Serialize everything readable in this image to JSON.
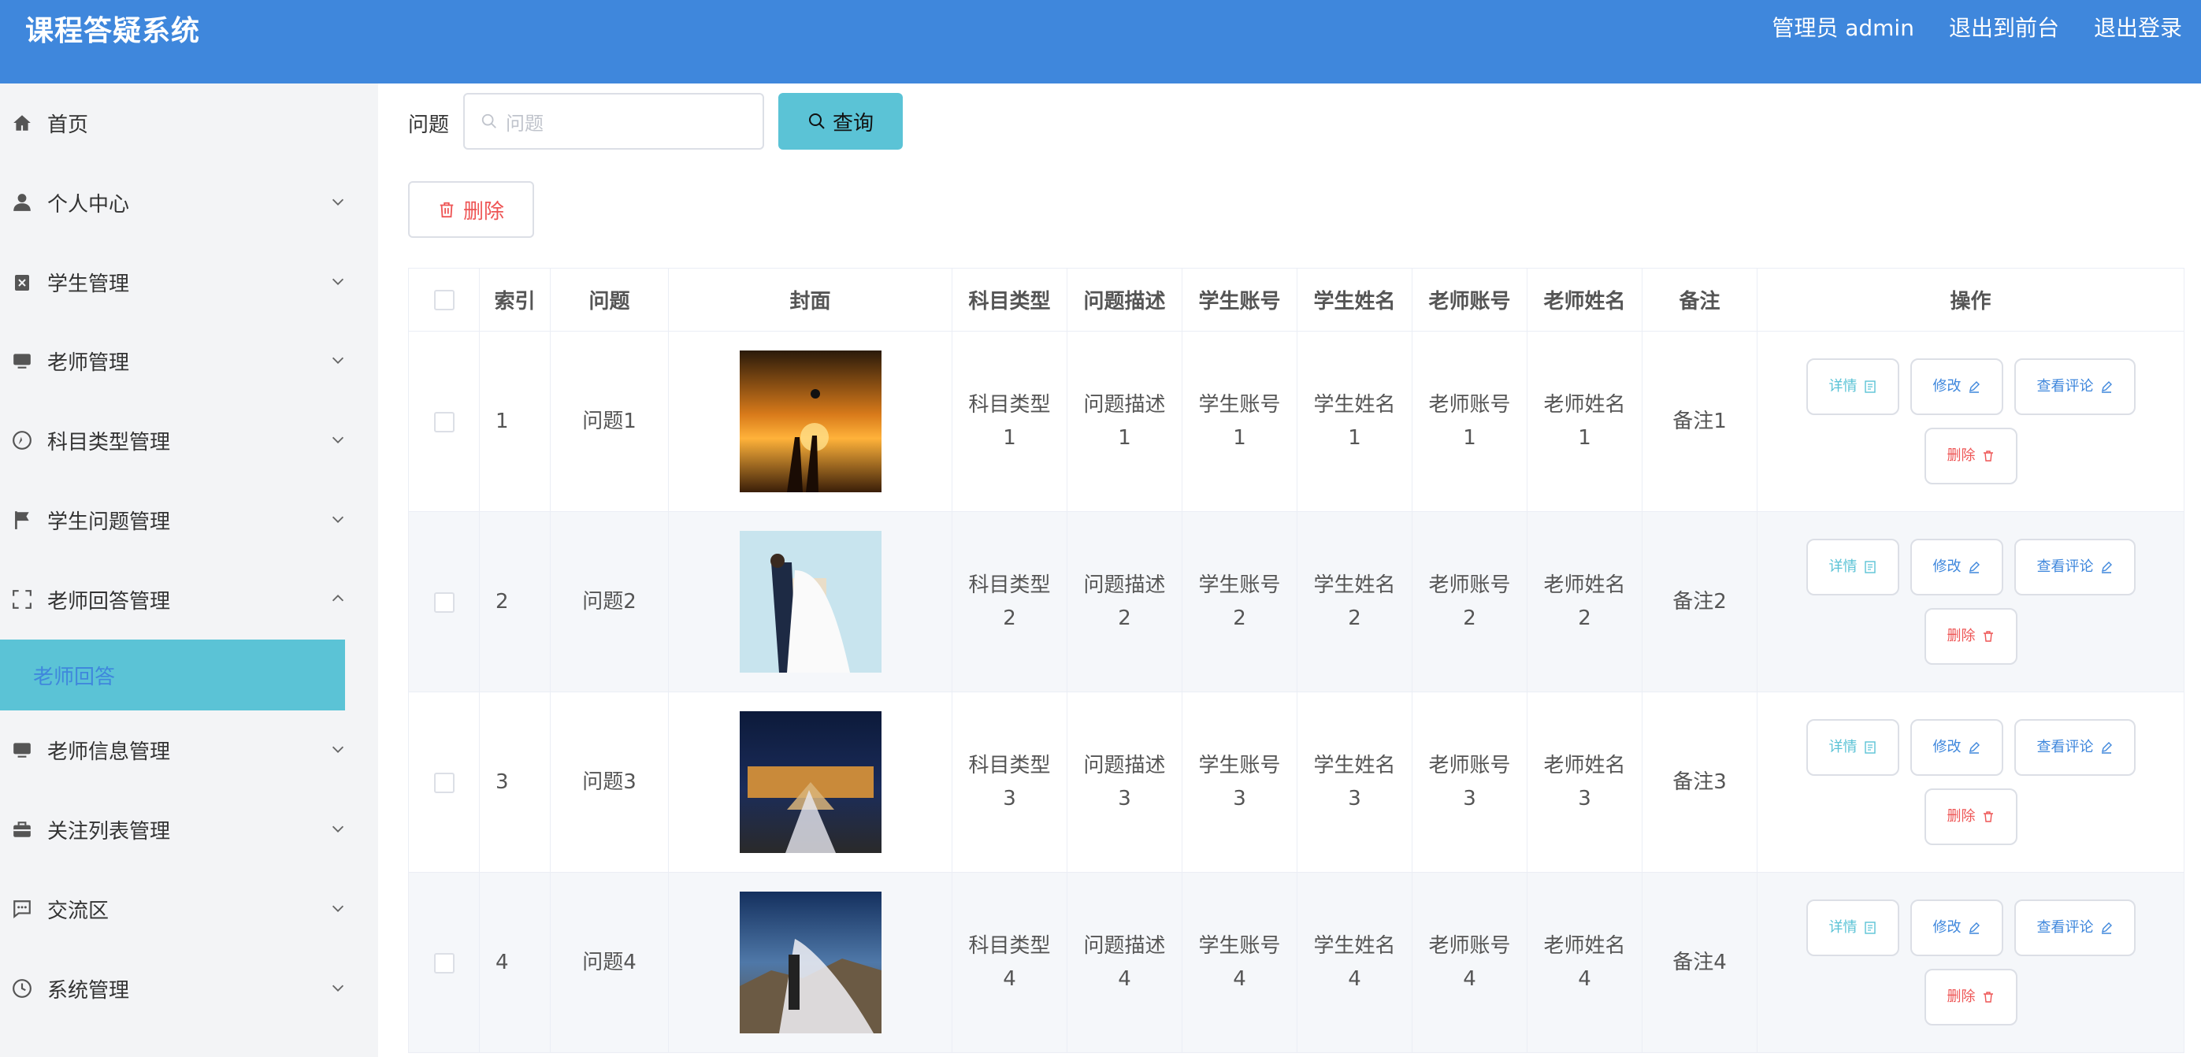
{
  "header": {
    "title": "课程答疑系统",
    "user": "管理员 admin",
    "to_front": "退出到前台",
    "logout": "退出登录"
  },
  "sidebar": {
    "items": [
      {
        "label": "首页",
        "icon": "home-icon"
      },
      {
        "label": "个人中心",
        "icon": "user-icon"
      },
      {
        "label": "学生管理",
        "icon": "clipboard-icon"
      },
      {
        "label": "老师管理",
        "icon": "monitor-icon"
      },
      {
        "label": "科目类型管理",
        "icon": "compass-icon"
      },
      {
        "label": "学生问题管理",
        "icon": "flag-icon"
      },
      {
        "label": "老师回答管理",
        "icon": "frame-icon"
      },
      {
        "label": "老师信息管理",
        "icon": "monitor-icon"
      },
      {
        "label": "关注列表管理",
        "icon": "briefcase-icon"
      },
      {
        "label": "交流区",
        "icon": "chat-icon"
      },
      {
        "label": "系统管理",
        "icon": "clock-icon"
      }
    ],
    "active_sub": "老师回答"
  },
  "search": {
    "label": "问题",
    "placeholder": "问题",
    "button": "查询"
  },
  "toolbar": {
    "delete": "删除"
  },
  "table": {
    "headers": [
      "索引",
      "问题",
      "封面",
      "科目类型",
      "问题描述",
      "学生账号",
      "学生姓名",
      "老师账号",
      "老师姓名",
      "备注",
      "操作"
    ],
    "actions": {
      "detail": "详情",
      "edit": "修改",
      "comment": "查看评论",
      "delete": "删除"
    },
    "rows": [
      {
        "index": "1",
        "question": "问题1",
        "subject": "科目类型1",
        "desc": "问题描述1",
        "stu_acc": "学生账号1",
        "stu_name": "学生姓名1",
        "tch_acc": "老师账号1",
        "tch_name": "老师姓名1",
        "note": "备注1",
        "cover": "sunset-couple"
      },
      {
        "index": "2",
        "question": "问题2",
        "subject": "科目类型2",
        "desc": "问题描述2",
        "stu_acc": "学生账号2",
        "stu_name": "学生姓名2",
        "tch_acc": "老师账号2",
        "tch_name": "老师姓名2",
        "note": "备注2",
        "cover": "wedding-studio"
      },
      {
        "index": "3",
        "question": "问题3",
        "subject": "科目类型3",
        "desc": "问题描述3",
        "stu_acc": "学生账号3",
        "stu_name": "学生姓名3",
        "tch_acc": "老师账号3",
        "tch_name": "老师姓名3",
        "note": "备注3",
        "cover": "night-palace"
      },
      {
        "index": "4",
        "question": "问题4",
        "subject": "科目类型4",
        "desc": "问题描述4",
        "stu_acc": "学生账号4",
        "stu_name": "学生姓名4",
        "tch_acc": "老师账号4",
        "tch_name": "老师姓名4",
        "note": "备注4",
        "cover": "great-wall"
      }
    ]
  },
  "colors": {
    "header": "#3f87dc",
    "accent": "#5bc3d6",
    "danger": "#ee5555"
  }
}
